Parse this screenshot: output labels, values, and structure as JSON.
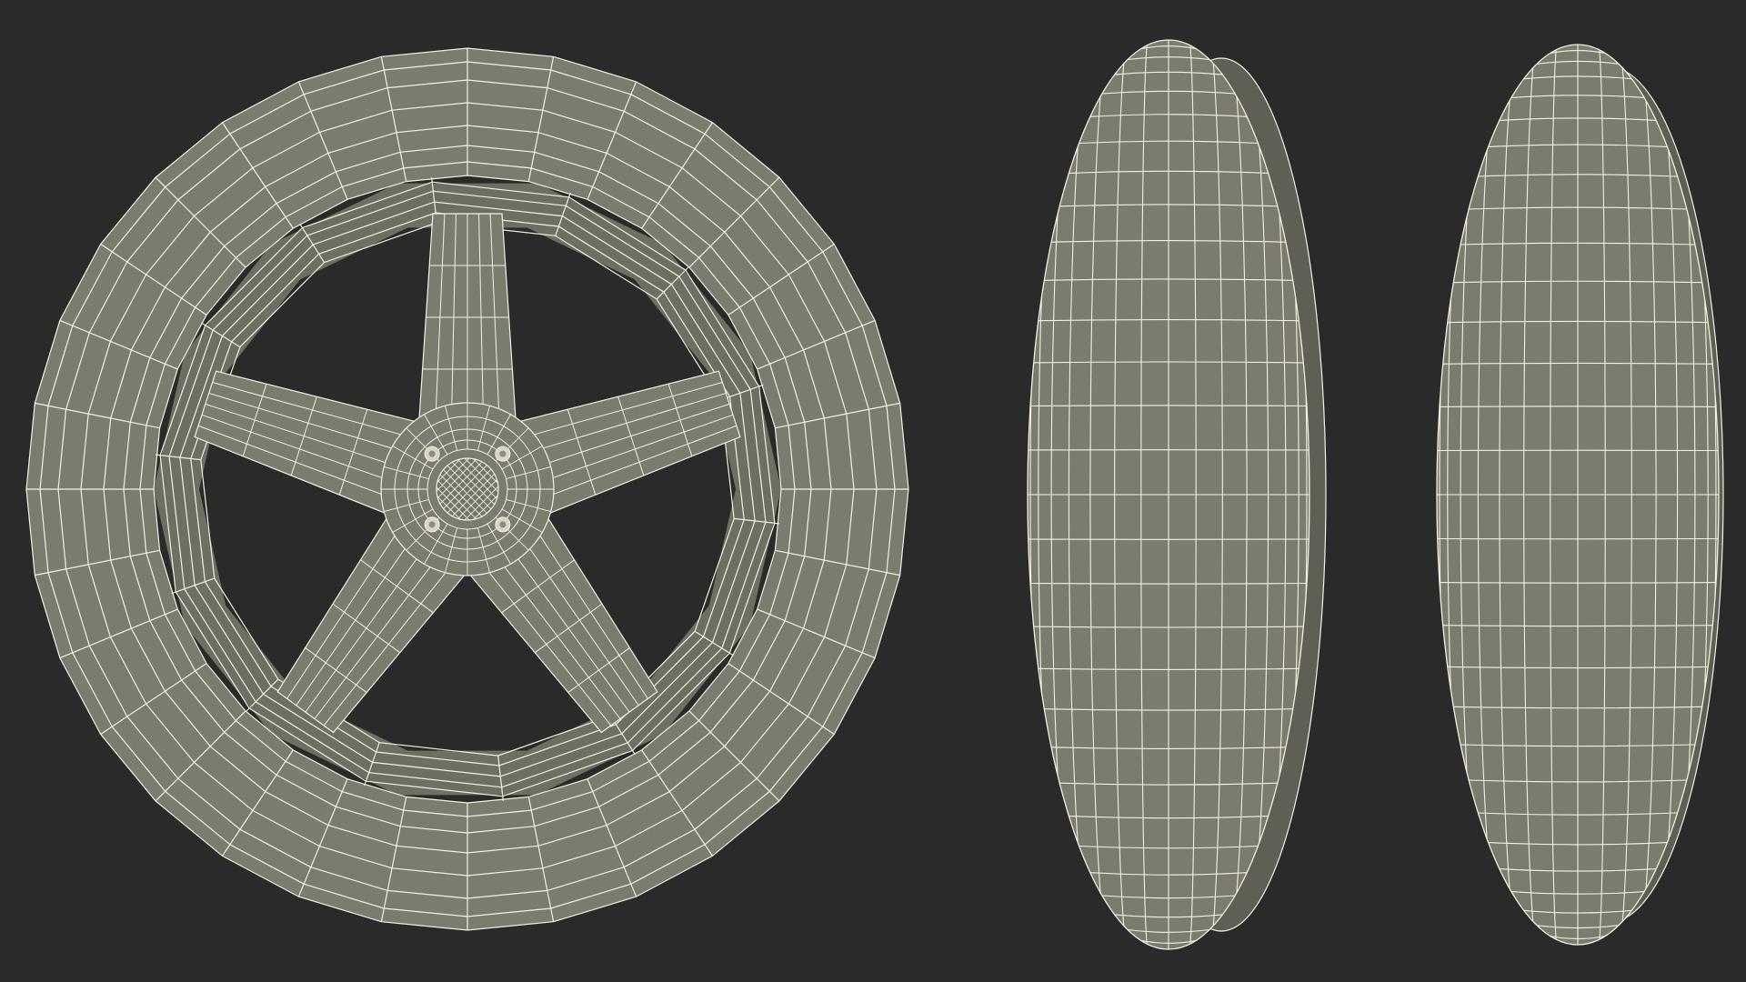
{
  "scene": {
    "background_color": "#2a2a2a",
    "mesh_fill_color": "#7b7c6f",
    "mesh_shade_color": "#5e5f55",
    "wire_color": "#f4f1e3",
    "views": [
      {
        "id": "front",
        "subject": "wheel-with-five-spoke-rim",
        "lug_nuts": 4,
        "spokes": 5
      },
      {
        "id": "side-1",
        "subject": "wheel-side-view"
      },
      {
        "id": "side-2",
        "subject": "wheel-side-view"
      }
    ]
  }
}
